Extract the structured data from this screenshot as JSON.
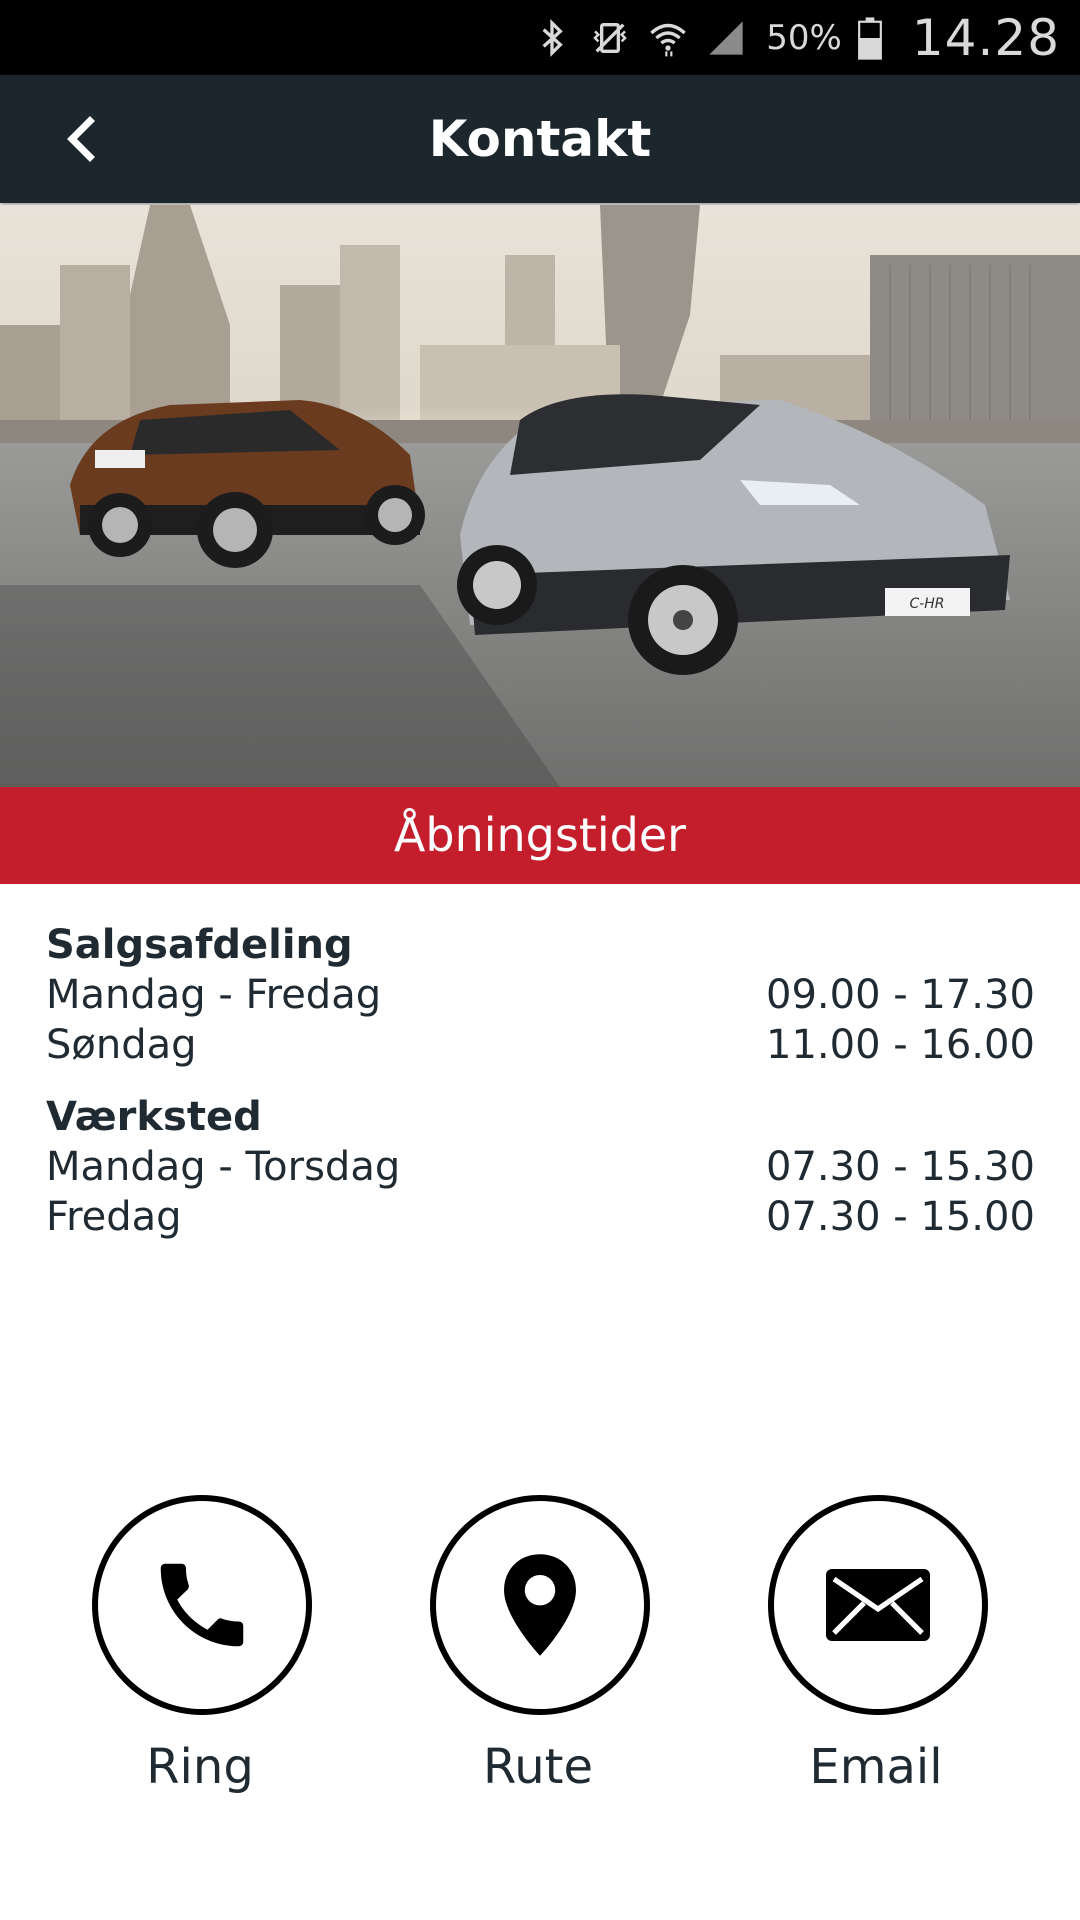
{
  "statusbar": {
    "battery_percent": "50%",
    "clock": "14.28",
    "icons": [
      "bluetooth-icon",
      "vibrate-icon",
      "wifi-icon",
      "signal-icon",
      "battery-icon"
    ]
  },
  "appbar": {
    "title": "Kontakt",
    "back_icon": "back-arrow-icon"
  },
  "hero": {
    "image": "two Toyota C-HR cars on a rooftop with city skyline",
    "plate_text": "C-HR"
  },
  "banner": {
    "title": "Åbningstider"
  },
  "hours": {
    "sales": {
      "title": "Salgsafdeling",
      "rows": [
        {
          "day": "Mandag - Fredag",
          "time": "09.00 - 17.30"
        },
        {
          "day": "Søndag",
          "time": "11.00 - 16.00"
        }
      ]
    },
    "workshop": {
      "title": "Værksted",
      "rows": [
        {
          "day": "Mandag - Torsdag",
          "time": "07.30 - 15.30"
        },
        {
          "day": "Fredag",
          "time": "07.30 - 15.00"
        }
      ]
    }
  },
  "actions": {
    "call": {
      "label": "Ring",
      "icon": "phone-icon"
    },
    "route": {
      "label": "Rute",
      "icon": "location-pin-icon"
    },
    "email": {
      "label": "Email",
      "icon": "envelope-icon"
    }
  }
}
